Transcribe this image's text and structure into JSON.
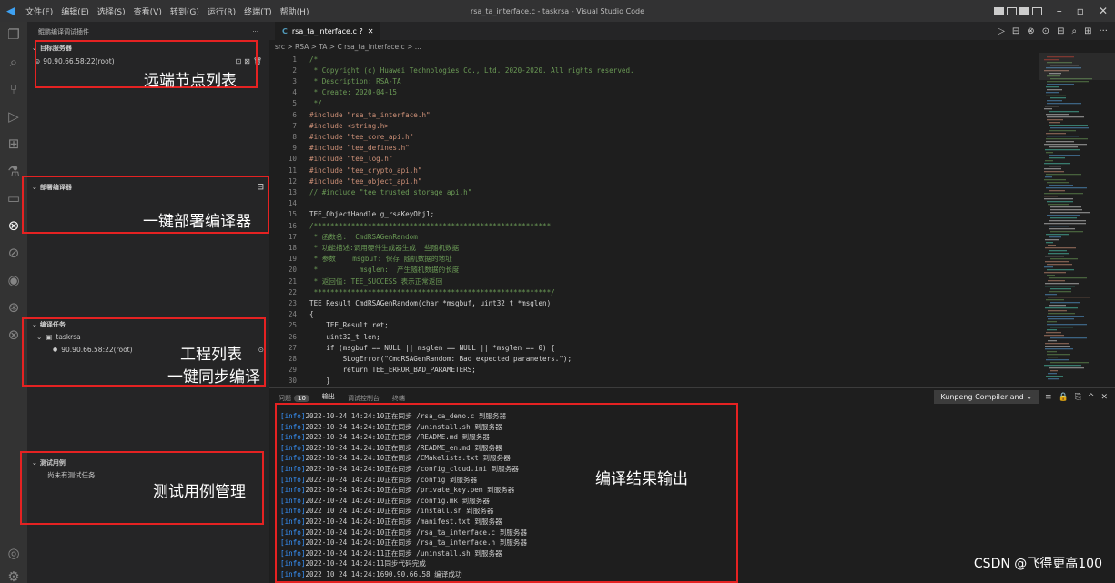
{
  "window": {
    "title": "rsa_ta_interface.c - taskrsa - Visual Studio Code",
    "menu": [
      "文件(F)",
      "编辑(E)",
      "选择(S)",
      "查看(V)",
      "转到(G)",
      "运行(R)",
      "终端(T)",
      "帮助(H)"
    ]
  },
  "sidebar": {
    "header": "鲲鹏编译调试插件",
    "sections": {
      "remote": {
        "title": "目标服务器",
        "item": "90.90.66.58:22(root)"
      },
      "deploy": {
        "title": "部署编译器"
      },
      "tasks": {
        "title": "编译任务",
        "project": "taskrsa",
        "host": "90.90.66.58:22(root)"
      },
      "tests": {
        "title": "测试用例",
        "empty_text": "尚未有测试任务"
      }
    }
  },
  "annotations": {
    "remote_nodes": "远端节点列表",
    "deploy_compiler": "一键部署编译器",
    "project_list": "工程列表",
    "sync_compile": "一键同步编译",
    "test_case_mgmt": "测试用例管理",
    "compile_output": "编译结果输出"
  },
  "editor": {
    "tab_prefix": "C",
    "tab_label": "rsa_ta_interface.c ?",
    "breadcrumb": "src > RSA > TA > C rsa_ta_interface.c > ...",
    "lines": [
      {
        "n": "1",
        "t": "/*",
        "c": "#6a9955"
      },
      {
        "n": "2",
        "t": " * Copyright (c) Huawei Technologies Co., Ltd. 2020-2020. All rights reserved.",
        "c": "#6a9955"
      },
      {
        "n": "3",
        "t": " * Description: RSA-TA",
        "c": "#6a9955"
      },
      {
        "n": "4",
        "t": " * Create: 2020-04-15",
        "c": "#6a9955"
      },
      {
        "n": "5",
        "t": " */",
        "c": "#6a9955"
      },
      {
        "n": "6",
        "t": "#include \"rsa_ta_interface.h\"",
        "c": "#ce9178"
      },
      {
        "n": "7",
        "t": "#include <string.h>",
        "c": "#ce9178"
      },
      {
        "n": "8",
        "t": "#include \"tee_core_api.h\"",
        "c": "#ce9178"
      },
      {
        "n": "9",
        "t": "#include \"tee_defines.h\"",
        "c": "#ce9178"
      },
      {
        "n": "10",
        "t": "#include \"tee_log.h\"",
        "c": "#ce9178"
      },
      {
        "n": "11",
        "t": "#include \"tee_crypto_api.h\"",
        "c": "#ce9178"
      },
      {
        "n": "12",
        "t": "#include \"tee_object_api.h\"",
        "c": "#ce9178"
      },
      {
        "n": "13",
        "t": "// #include \"tee_trusted_storage_api.h\"",
        "c": "#6a9955"
      },
      {
        "n": "14",
        "t": "",
        "c": "#d4d4d4"
      },
      {
        "n": "15",
        "t": "TEE_ObjectHandle g_rsaKeyObj1;",
        "c": "#d4d4d4"
      },
      {
        "n": "16",
        "t": "/*********************************************************",
        "c": "#6a9955"
      },
      {
        "n": "17",
        "t": " * 函数名:  CmdRSAGenRandom",
        "c": "#6a9955"
      },
      {
        "n": "18",
        "t": " * 功能描述:调用硬件生成器生成  些随机数据",
        "c": "#6a9955"
      },
      {
        "n": "19",
        "t": " * 参数    msgbuf: 保存 随机数据的地址",
        "c": "#6a9955"
      },
      {
        "n": "20",
        "t": " *          msglen:  产生随机数据的长度",
        "c": "#6a9955"
      },
      {
        "n": "21",
        "t": " * 返回值: TEE_SUCCESS 表示正常返回",
        "c": "#6a9955"
      },
      {
        "n": "22",
        "t": " *********************************************************/",
        "c": "#6a9955"
      },
      {
        "n": "23",
        "t": "TEE_Result CmdRSAGenRandom(char *msgbuf, uint32_t *msglen)",
        "c": "#d4d4d4"
      },
      {
        "n": "24",
        "t": "{",
        "c": "#d4d4d4"
      },
      {
        "n": "25",
        "t": "    TEE_Result ret;",
        "c": "#d4d4d4"
      },
      {
        "n": "26",
        "t": "    uint32_t len;",
        "c": "#d4d4d4"
      },
      {
        "n": "27",
        "t": "    if (msgbuf == NULL || msglen == NULL || *msglen == 0) {",
        "c": "#d4d4d4"
      },
      {
        "n": "28",
        "t": "        SLogError(\"CmdRSAGenRandom: Bad expected parameters.\");",
        "c": "#d4d4d4"
      },
      {
        "n": "29",
        "t": "        return TEE_ERROR_BAD_PARAMETERS;",
        "c": "#d4d4d4"
      },
      {
        "n": "30",
        "t": "    }",
        "c": "#d4d4d4"
      }
    ]
  },
  "panel": {
    "tabs": [
      "问题",
      "输出",
      "调试控制台",
      "终端"
    ],
    "problems_count": "10",
    "output_channel": "Kunpeng Compiler and",
    "output_lines": [
      {
        "lvl": "[info]",
        "ts": "2022-10-24 14:24:10",
        "msg": "正在同步 /rsa_ca_demo.c 到服务器"
      },
      {
        "lvl": "[info]",
        "ts": "2022-10-24 14:24:10",
        "msg": "正在同步 /uninstall.sh 到服务器"
      },
      {
        "lvl": "[info]",
        "ts": "2022-10-24 14:24:10",
        "msg": "正在同步 /README.md 到服务器"
      },
      {
        "lvl": "[info]",
        "ts": "2022-10-24 14:24:10",
        "msg": "正在同步 /README_en.md 到服务器"
      },
      {
        "lvl": "[info]",
        "ts": "2022-10-24 14:24:10",
        "msg": "正在同步 /CMakelists.txt 到服务器"
      },
      {
        "lvl": "[info]",
        "ts": "2022-10-24 14:24:10",
        "msg": "正在同步 /config_cloud.ini 到服务器"
      },
      {
        "lvl": "[info]",
        "ts": "2022-10-24 14:24:10",
        "msg": "正在同步 /config 到服务器"
      },
      {
        "lvl": "[info]",
        "ts": "2022-10-24 14:24:10",
        "msg": "正在同步 /private_key.pem 到服务器"
      },
      {
        "lvl": "[info]",
        "ts": "2022-10-24 14:24:10",
        "msg": "正在同步 /config.mk 到服务器"
      },
      {
        "lvl": "[info]",
        "ts": "2022 10 24 14:24:10",
        "msg": "正在同步 /install.sh 到服务器"
      },
      {
        "lvl": "[info]",
        "ts": "2022-10-24 14:24:10",
        "msg": "正在同步 /manifest.txt 到服务器"
      },
      {
        "lvl": "[info]",
        "ts": "2022-10-24 14:24:10",
        "msg": "正在同步 /rsa_ta_interface.c 到服务器"
      },
      {
        "lvl": "[info]",
        "ts": "2022-10-24 14:24:10",
        "msg": "正在同步 /rsa_ta_interface.h 到服务器"
      },
      {
        "lvl": "[info]",
        "ts": "2022-10-24 14:24:11",
        "msg": "正在同步 /uninstall.sh 到服务器"
      },
      {
        "lvl": "[info]",
        "ts": "2022-10-24 14:24:11",
        "msg": "同步代码完成"
      },
      {
        "lvl": "[info]",
        "ts": "2022 10 24 14:24:16",
        "msg": "90.90.66.58 编译成功"
      }
    ]
  },
  "watermark": "CSDN @飞得更高100"
}
